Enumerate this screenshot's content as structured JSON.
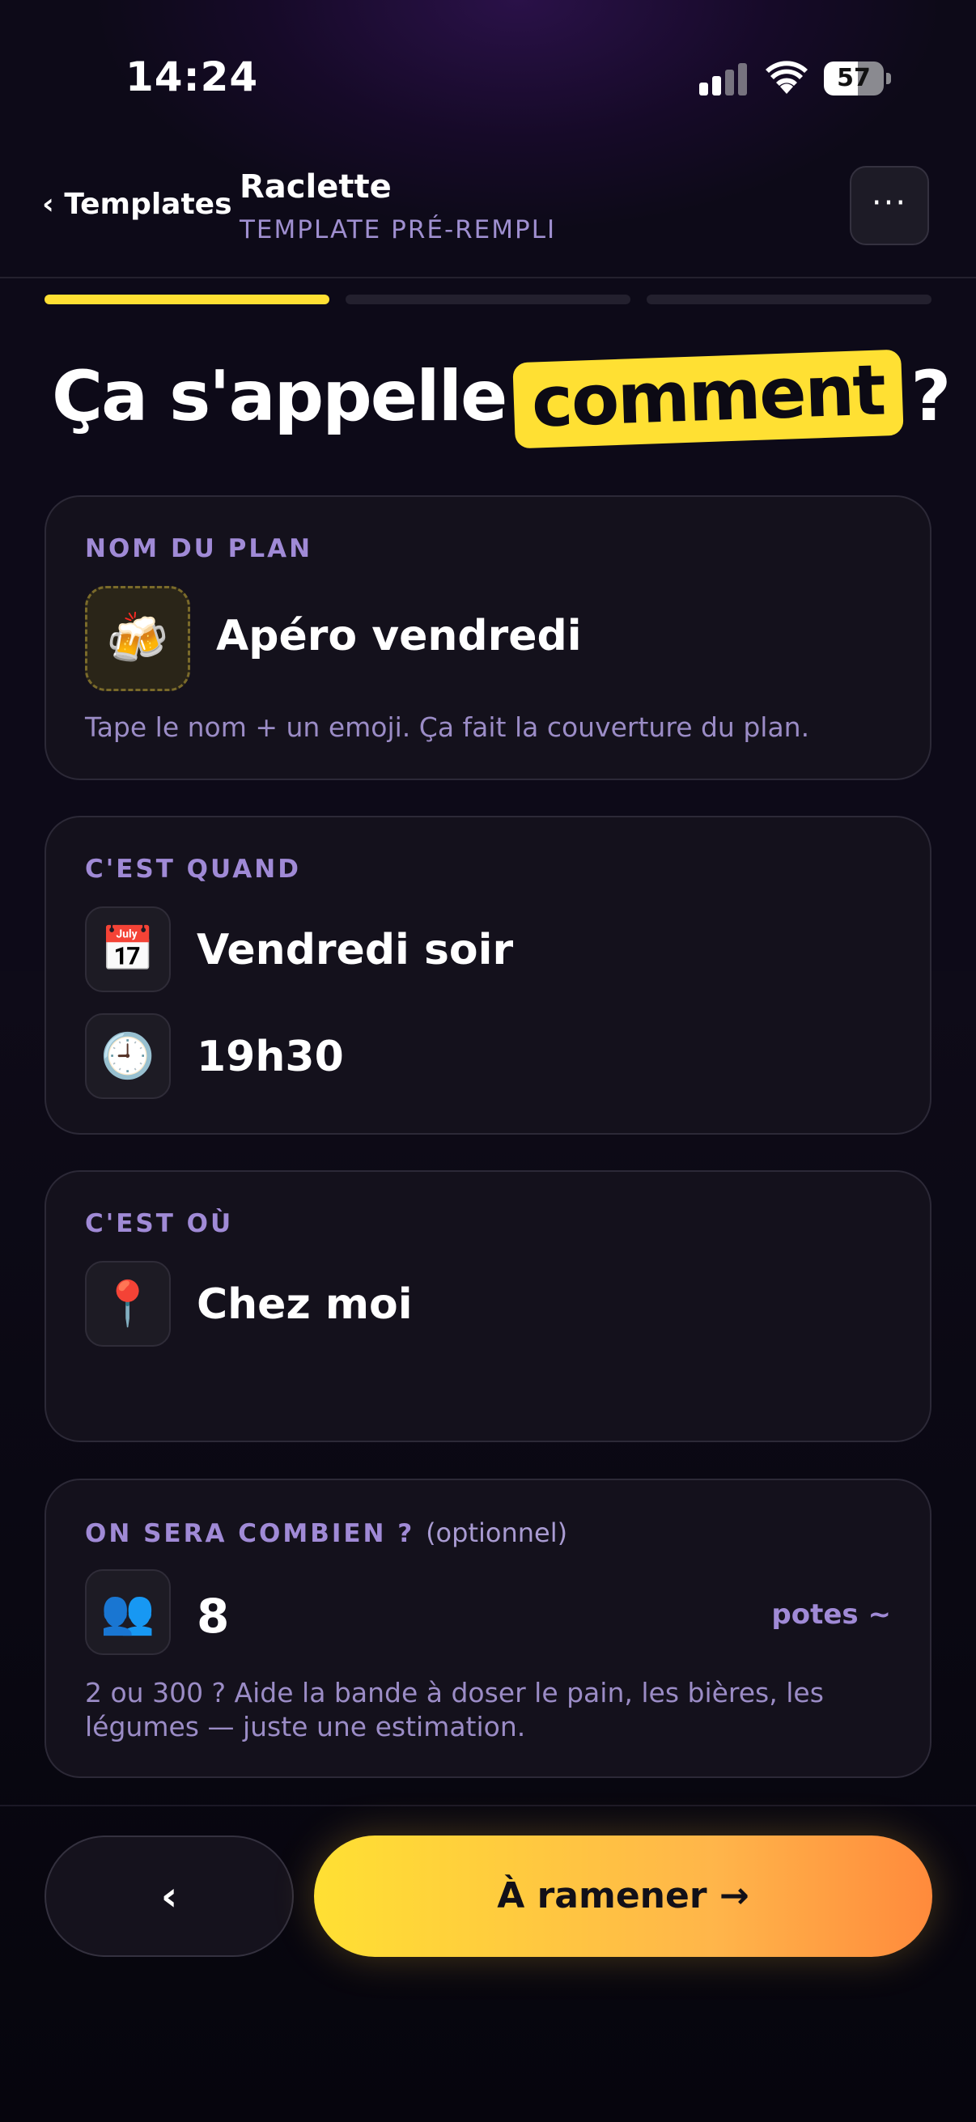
{
  "status_bar": {
    "time": "14:24",
    "battery": "57",
    "battery_level": 0.57
  },
  "nav": {
    "back_label": "‹ Templates",
    "title": "Raclette",
    "subtitle": "TEMPLATE PRÉ-REMPLI",
    "more_label": "···"
  },
  "progress": {
    "total_steps": 3,
    "current_step": 1
  },
  "heading": {
    "before": "Ça s'appelle",
    "highlight": "comment",
    "after": "?"
  },
  "cards": {
    "name": {
      "label": "NOM DU PLAN",
      "emoji": "🍻",
      "value": "Apéro vendredi",
      "help": "Tape le nom + un emoji. Ça fait la couverture du plan."
    },
    "when": {
      "label": "C'EST QUAND",
      "date_emoji": "📅",
      "date_value": "Vendredi soir",
      "time_emoji": "🕘",
      "time_value": "19h30"
    },
    "where": {
      "label": "C'EST OÙ",
      "emoji": "📍",
      "value": "Chez moi"
    },
    "count": {
      "label": "ON SERA COMBIEN ?",
      "optional": "(optionnel)",
      "emoji": "👥",
      "value": "8",
      "unit": "potes ~",
      "help": "2 ou 300 ? Aide la bande à doser le pain, les bières, les légumes — juste une estimation."
    }
  },
  "footer": {
    "back_label": "‹",
    "next_label": "À ramener →"
  },
  "colors": {
    "accent": "#ffe033",
    "accent_end": "#ff8a3c",
    "label": "#a08ad6",
    "card_bg": "#14111c"
  }
}
